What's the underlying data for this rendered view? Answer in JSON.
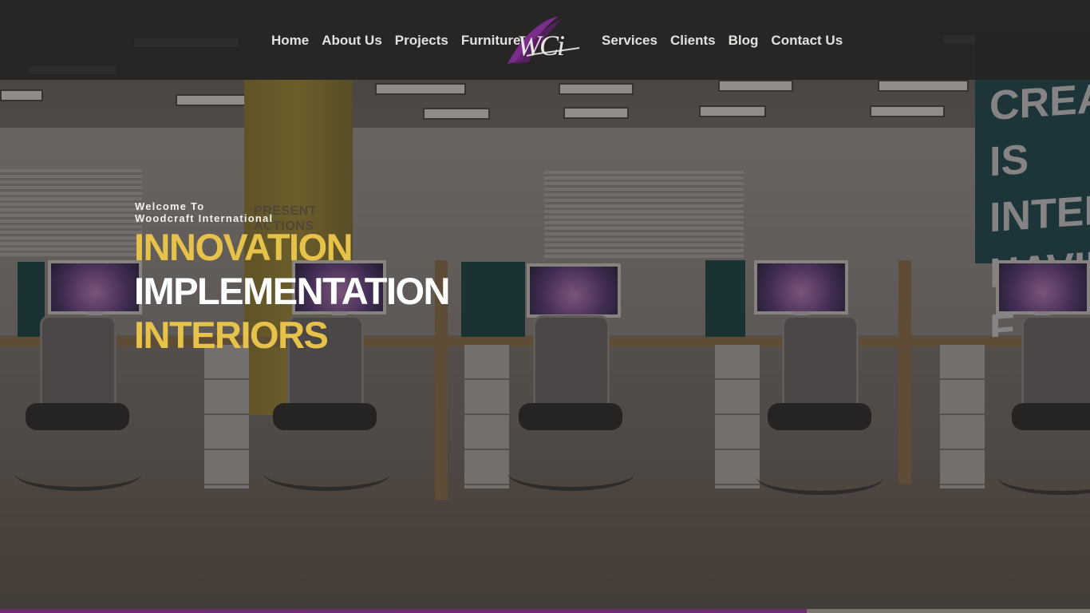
{
  "nav": {
    "left": [
      "Home",
      "About Us",
      "Projects",
      "Furniture"
    ],
    "right": [
      "Services",
      "Clients",
      "Blog",
      "Contact Us"
    ]
  },
  "logo": {
    "text": "WCi",
    "color": "#7b2d8b"
  },
  "hero": {
    "welcome_line1": "Welcome To",
    "welcome_line2": "Woodcraft International",
    "headline": [
      "INNOVATION",
      "IMPLEMENTATION",
      "INTERIORS"
    ],
    "accent_color": "#e6c24a",
    "background_wall_text": {
      "pillar": "PRESENT\nACTIONS",
      "teal_wall": "CREATI\nIS INTELLIG\nHAVING F"
    }
  },
  "slider": {
    "progress": 0.74,
    "color": "#6e2d73"
  }
}
